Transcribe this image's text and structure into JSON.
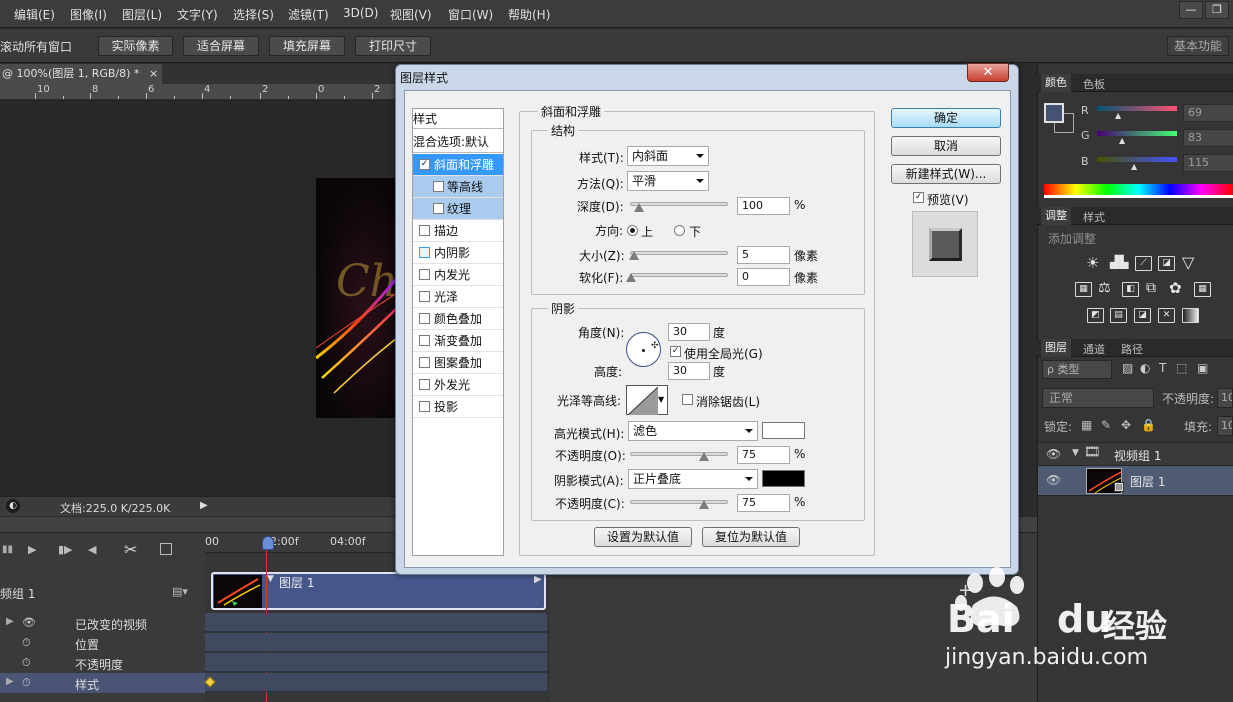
{
  "menubar": {
    "items": [
      "编辑(E)",
      "图像(I)",
      "图层(L)",
      "文字(Y)",
      "选择(S)",
      "滤镜(T)",
      "3D(D)",
      "视图(V)",
      "窗口(W)",
      "帮助(H)"
    ],
    "minimize": "—",
    "restore": "❐"
  },
  "options": {
    "scroll_all": "滚动所有窗口",
    "actual_pixels": "实际像素",
    "fit_screen": "适合屏幕",
    "fill_screen": "填充屏幕",
    "print_size": "打印尺寸",
    "workspace": "基本功能"
  },
  "document": {
    "tab_title": "@ 100%(图层 1, RGB/8) *",
    "tab_close": "×",
    "ruler_labels": [
      "10",
      "8",
      "6",
      "4",
      "2",
      "0",
      "2"
    ],
    "artwork_text": "Ch",
    "status": "文档:225.0 K/225.0K"
  },
  "timeline": {
    "ruler_labels": [
      "00",
      "02:00f",
      "04:00f"
    ],
    "group_label": "频组 1",
    "clip_label": "图层 1",
    "rows": [
      {
        "label": "已改变的视频",
        "icon": "👁"
      },
      {
        "label": "位置",
        "icon": "⏱"
      },
      {
        "label": "不透明度",
        "icon": "⏱"
      },
      {
        "label": "样式",
        "icon": "⏱"
      }
    ],
    "add_button": "+"
  },
  "color_panel": {
    "tabs": [
      "颜色",
      "色板"
    ],
    "channels": [
      {
        "name": "R",
        "value": "69"
      },
      {
        "name": "G",
        "value": "83"
      },
      {
        "name": "B",
        "value": "115"
      }
    ],
    "swatch_color": "#455373"
  },
  "adjust_panel": {
    "tabs": [
      "调整",
      "样式"
    ],
    "title": "添加调整"
  },
  "layers_panel": {
    "tabs": [
      "图层",
      "通道",
      "路径"
    ],
    "filter_type": "ρ 类型",
    "blend_mode": "正常",
    "opacity_label": "不透明度:",
    "opacity_value": "10",
    "lock_label": "锁定:",
    "fill_label": "填充:",
    "fill_value": "10",
    "layers": [
      {
        "name": "视频组 1",
        "type": "group"
      },
      {
        "name": "图层 1",
        "type": "layer"
      }
    ]
  },
  "dialog": {
    "title": "图层样式",
    "close": "✕",
    "styles_header": "样式",
    "blend_options": "混合选项:默认",
    "style_items": [
      {
        "label": "斜面和浮雕",
        "checked": true,
        "state": "selected"
      },
      {
        "label": "等高线",
        "checked": false,
        "state": "sub"
      },
      {
        "label": "纹理",
        "checked": false,
        "state": "sub"
      },
      {
        "label": "描边",
        "checked": false,
        "state": "normal"
      },
      {
        "label": "内阴影",
        "checked": false,
        "state": "normal"
      },
      {
        "label": "内发光",
        "checked": false,
        "state": "normal"
      },
      {
        "label": "光泽",
        "checked": false,
        "state": "normal"
      },
      {
        "label": "颜色叠加",
        "checked": false,
        "state": "normal"
      },
      {
        "label": "渐变叠加",
        "checked": false,
        "state": "normal"
      },
      {
        "label": "图案叠加",
        "checked": false,
        "state": "normal"
      },
      {
        "label": "外发光",
        "checked": false,
        "state": "normal"
      },
      {
        "label": "投影",
        "checked": false,
        "state": "normal"
      }
    ],
    "section_title": "斜面和浮雕",
    "structure": {
      "title": "结构",
      "style_label": "样式(T):",
      "style_value": "内斜面",
      "technique_label": "方法(Q):",
      "technique_value": "平滑",
      "depth_label": "深度(D):",
      "depth_value": "100",
      "depth_unit": "%",
      "direction_label": "方向:",
      "direction_up": "上",
      "direction_down": "下",
      "size_label": "大小(Z):",
      "size_value": "5",
      "size_unit": "像素",
      "soften_label": "软化(F):",
      "soften_value": "0",
      "soften_unit": "像素"
    },
    "shading": {
      "title": "阴影",
      "angle_label": "角度(N):",
      "angle_value": "30",
      "angle_unit": "度",
      "global_light": "使用全局光(G)",
      "altitude_label": "高度:",
      "altitude_value": "30",
      "altitude_unit": "度",
      "gloss_label": "光泽等高线:",
      "antialias": "消除锯齿(L)",
      "highlight_label": "高光模式(H):",
      "highlight_value": "滤色",
      "highlight_color": "#ffffff",
      "hl_opacity_label": "不透明度(O):",
      "hl_opacity_value": "75",
      "shadow_label": "阴影模式(A):",
      "shadow_value": "正片叠底",
      "shadow_color": "#000000",
      "sh_opacity_label": "不透明度(C):",
      "sh_opacity_value": "75",
      "percent": "%"
    },
    "make_default": "设置为默认值",
    "reset_default": "复位为默认值",
    "ok": "确定",
    "cancel": "取消",
    "new_style": "新建样式(W)...",
    "preview": "预览(V)"
  },
  "watermark": {
    "brand_left": "Bai",
    "brand_right": "du",
    "brand_cn": "经验",
    "url": "jingyan.baidu.com"
  }
}
